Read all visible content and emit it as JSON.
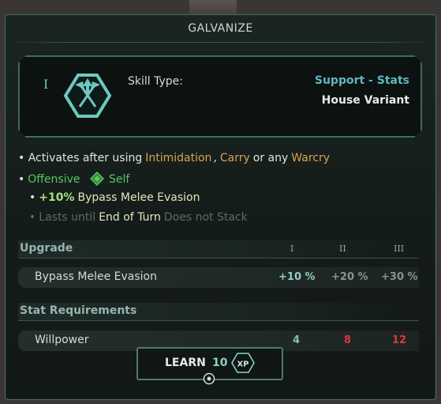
{
  "panel": {
    "title": "GALVANIZE"
  },
  "skill": {
    "tier": "I",
    "icon": "crossed-axes-hex-icon",
    "type_label": "Skill Type:",
    "type_value": "Support - Stats",
    "variant": "House Variant"
  },
  "description": {
    "line1": {
      "prefix": "• Activates after using",
      "skill_a": "Intimidation",
      "sep1": ",",
      "skill_b": "Carry",
      "mid": "or any",
      "skill_c": "Warcry"
    },
    "line2": {
      "bullet": "•",
      "kind": "Offensive",
      "target_icon": "green-diamond-icon",
      "target": "Self"
    },
    "line3": {
      "bullet": "•",
      "amount": "+10%",
      "effect": "Bypass Melee Evasion"
    },
    "line4": {
      "bullet": "•",
      "prefix": "Lasts until",
      "duration": "End of Turn",
      "suffix": "Does not Stack"
    }
  },
  "upgrade": {
    "header": "Upgrade",
    "tiers": [
      "I",
      "II",
      "III"
    ],
    "row": {
      "name": "Bypass Melee Evasion",
      "values": [
        "+10 %",
        "+20 %",
        "+30 %"
      ]
    }
  },
  "requirements": {
    "header": "Stat Requirements",
    "row": {
      "name": "Willpower",
      "values": [
        "4",
        "8",
        "12"
      ]
    }
  },
  "learn": {
    "label": "LEARN",
    "cost": "10",
    "currency": "XP"
  },
  "colors": {
    "accent_teal": "#5fb6c0",
    "skill_orange": "#d9a352",
    "positive_green": "#5cc45c",
    "requirement_met": "#7ac7a8",
    "requirement_unmet": "#d93a3a"
  }
}
